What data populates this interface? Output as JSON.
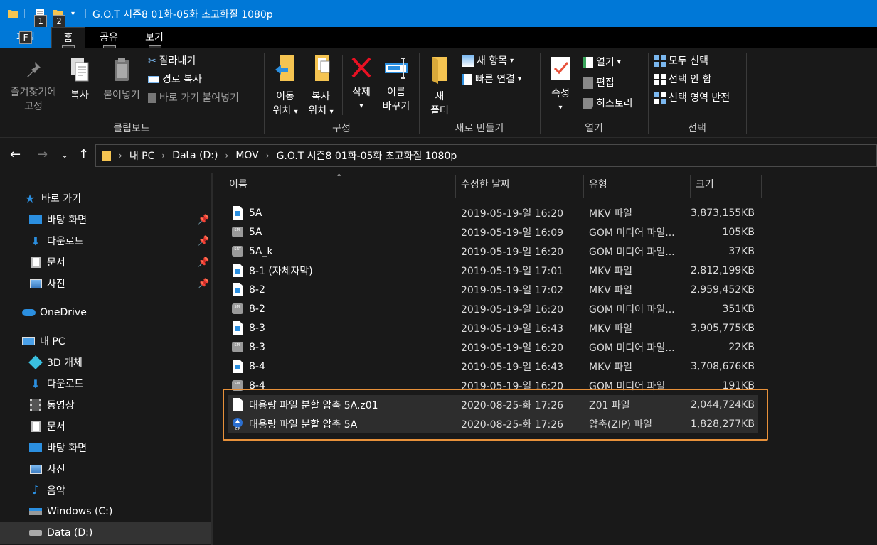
{
  "window": {
    "title": "G.O.T 시즌8 01화-05화 초고화질 1080p"
  },
  "keytips": {
    "qat1": "1",
    "qat2": "2",
    "file": "F",
    "home": "H",
    "share": "S",
    "view": "V"
  },
  "tabs": {
    "file": "파일",
    "home": "홈",
    "share": "공유",
    "view": "보기"
  },
  "ribbon": {
    "clipboard": {
      "pin": "즐겨찾기에\n고정",
      "pin_l1": "즐겨찾기에",
      "pin_l2": "고정",
      "copy": "복사",
      "paste": "붙여넣기",
      "cut": "잘라내기",
      "copy_path": "경로 복사",
      "paste_shortcut": "바로 가기 붙여넣기",
      "group": "클립보드"
    },
    "organize": {
      "move_l1": "이동",
      "move_l2": "위치",
      "copyto_l1": "복사",
      "copyto_l2": "위치",
      "delete": "삭제",
      "rename_l1": "이름",
      "rename_l2": "바꾸기",
      "group": "구성"
    },
    "new": {
      "folder_l1": "새",
      "folder_l2": "폴더",
      "new_item": "새 항목",
      "easy_access": "빠른 연결",
      "group": "새로 만들기"
    },
    "open": {
      "properties": "속성",
      "open": "열기",
      "edit": "편집",
      "history": "히스토리",
      "group": "열기"
    },
    "select": {
      "select_all": "모두 선택",
      "select_none": "선택 안 함",
      "invert": "선택 영역 반전",
      "group": "선택"
    }
  },
  "address": {
    "crumbs": [
      "내 PC",
      "Data (D:)",
      "MOV",
      "G.O.T 시즌8 01화-05화 초고화질 1080p"
    ]
  },
  "sidebar": {
    "quick_access": "바로 가기",
    "qa_items": [
      "바탕 화면",
      "다운로드",
      "문서",
      "사진"
    ],
    "onedrive": "OneDrive",
    "this_pc": "내 PC",
    "pc_items": [
      "3D 개체",
      "다운로드",
      "동영상",
      "문서",
      "바탕 화면",
      "사진",
      "음악",
      "Windows (C:)",
      "Data (D:)"
    ]
  },
  "columns": {
    "name": "이름",
    "date": "수정한 날짜",
    "type": "유형",
    "size": "크기"
  },
  "files": [
    {
      "name": "5A",
      "date": "2019-05-19-일 16:20",
      "type": "MKV 파일",
      "size": "3,873,155KB",
      "icon": "mkv-file-icon"
    },
    {
      "name": "5A",
      "date": "2019-05-19-일 16:09",
      "type": "GOM 미디어 파일...",
      "size": "105KB",
      "icon": "smi-file-icon"
    },
    {
      "name": "5A_k",
      "date": "2019-05-19-일 16:20",
      "type": "GOM 미디어 파일...",
      "size": "37KB",
      "icon": "srt-file-icon"
    },
    {
      "name": "8-1 (자체자막)",
      "date": "2019-05-19-일 17:01",
      "type": "MKV 파일",
      "size": "2,812,199KB",
      "icon": "mkv-file-icon"
    },
    {
      "name": "8-2",
      "date": "2019-05-19-일 17:02",
      "type": "MKV 파일",
      "size": "2,959,452KB",
      "icon": "mkv-file-icon"
    },
    {
      "name": "8-2",
      "date": "2019-05-19-일 16:20",
      "type": "GOM 미디어 파일...",
      "size": "351KB",
      "icon": "smi-file-icon"
    },
    {
      "name": "8-3",
      "date": "2019-05-19-일 16:43",
      "type": "MKV 파일",
      "size": "3,905,775KB",
      "icon": "mkv-file-icon"
    },
    {
      "name": "8-3",
      "date": "2019-05-19-일 16:20",
      "type": "GOM 미디어 파일...",
      "size": "22KB",
      "icon": "smi-file-icon"
    },
    {
      "name": "8-4",
      "date": "2019-05-19-일 16:43",
      "type": "MKV 파일",
      "size": "3,708,676KB",
      "icon": "mkv-file-icon"
    },
    {
      "name": "8-4",
      "date": "2019-05-19-일 16:20",
      "type": "GOM 미디어 파일",
      "size": "191KB",
      "icon": "smi-file-icon"
    },
    {
      "name": "대용량 파일 분할 압축 5A.z01",
      "date": "2020-08-25-화 17:26",
      "type": "Z01 파일",
      "size": "2,044,724KB",
      "icon": "blank-file-icon"
    },
    {
      "name": "대용량 파일 분할 압축 5A",
      "date": "2020-08-25-화 17:26",
      "type": "압축(ZIP) 파일",
      "size": "1,828,277KB",
      "icon": "zip-file-icon"
    }
  ],
  "colors": {
    "titlebar": "#0078d7",
    "highlight_border": "#e8913a",
    "folder": "#f5c451"
  }
}
